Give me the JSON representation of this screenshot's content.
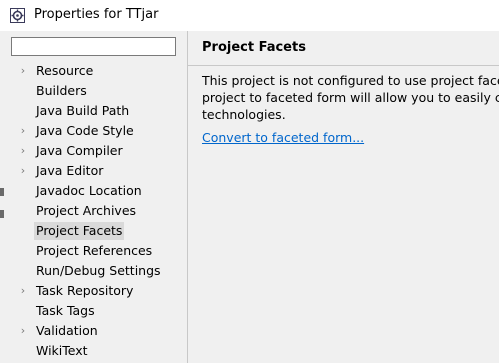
{
  "window": {
    "title": "Properties for TTjar"
  },
  "filter": {
    "value": "",
    "placeholder": ""
  },
  "tree": {
    "items": [
      {
        "label": "Resource",
        "expandable": true,
        "selected": false
      },
      {
        "label": "Builders",
        "expandable": false,
        "selected": false
      },
      {
        "label": "Java Build Path",
        "expandable": false,
        "selected": false
      },
      {
        "label": "Java Code Style",
        "expandable": true,
        "selected": false
      },
      {
        "label": "Java Compiler",
        "expandable": true,
        "selected": false
      },
      {
        "label": "Java Editor",
        "expandable": true,
        "selected": false
      },
      {
        "label": "Javadoc Location",
        "expandable": false,
        "selected": false
      },
      {
        "label": "Project Archives",
        "expandable": false,
        "selected": false
      },
      {
        "label": "Project Facets",
        "expandable": false,
        "selected": true
      },
      {
        "label": "Project References",
        "expandable": false,
        "selected": false
      },
      {
        "label": "Run/Debug Settings",
        "expandable": false,
        "selected": false
      },
      {
        "label": "Task Repository",
        "expandable": true,
        "selected": false
      },
      {
        "label": "Task Tags",
        "expandable": false,
        "selected": false
      },
      {
        "label": "Validation",
        "expandable": true,
        "selected": false
      },
      {
        "label": "WikiText",
        "expandable": false,
        "selected": false
      }
    ]
  },
  "page": {
    "title": "Project Facets",
    "description_lines": [
      "This project is not configured to use project facets.",
      "project to faceted form will allow you to easily cont",
      "technologies."
    ],
    "link": "Convert to faceted form..."
  },
  "colors": {
    "link": "#0066cc",
    "selection": "#d9d9d9",
    "pane_bg": "#f0f0f0"
  }
}
